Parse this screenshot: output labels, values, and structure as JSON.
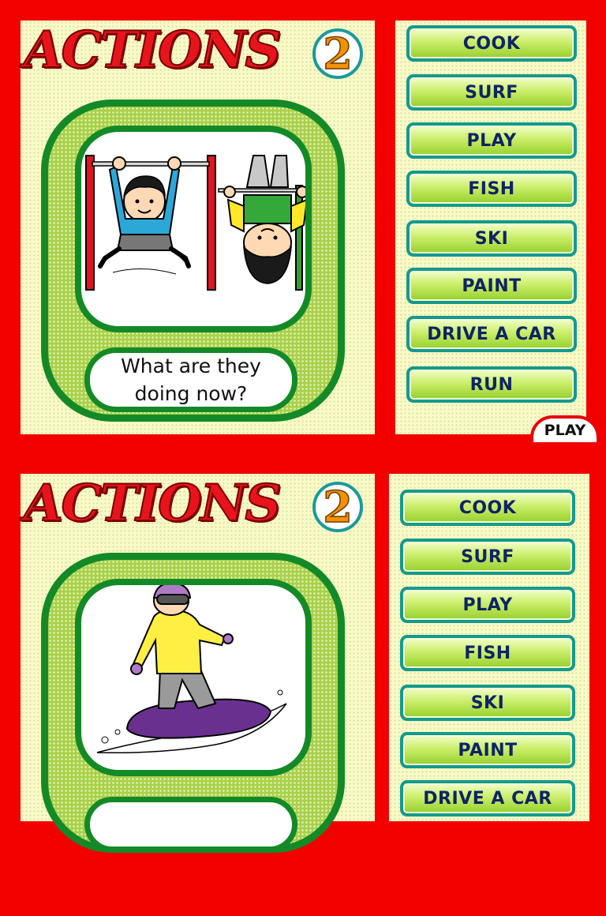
{
  "slides": [
    {
      "title": "ACTIONS",
      "title_number": "2",
      "question_line1": "What are they",
      "question_line2": "doing now?",
      "options": [
        "COOK",
        "SURF",
        "PLAY",
        "FISH",
        "SKI",
        "PAINT",
        "DRIVE A CAR",
        "RUN"
      ],
      "play_label": "PLAY"
    },
    {
      "title": "ACTIONS",
      "title_number": "2",
      "options": [
        "COOK",
        "SURF",
        "PLAY",
        "FISH",
        "SKI",
        "PAINT",
        "DRIVE A CAR"
      ]
    }
  ],
  "colors": {
    "background": "#f20000",
    "panel": "#fafac8",
    "frame_green": "#138a27",
    "button_border": "#149a8c",
    "button_text": "#0d2466",
    "title_red": "#e8141c",
    "number_orange": "#f39200"
  },
  "icons": [
    "kids-hanging-on-bars-illustration",
    "snowboarder-illustration"
  ]
}
